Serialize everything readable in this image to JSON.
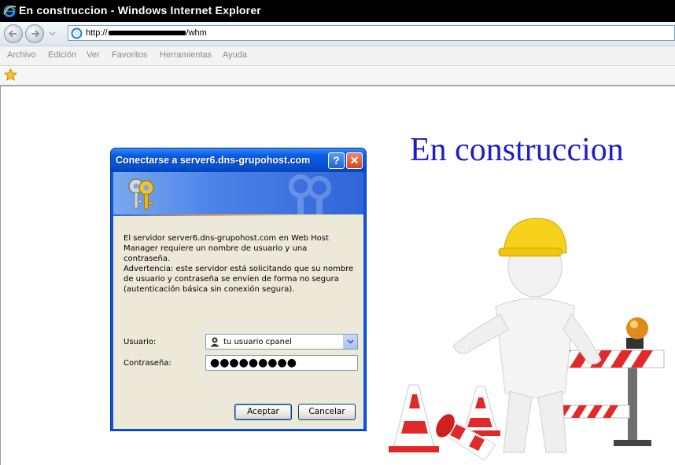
{
  "window": {
    "title": "En construccion - Windows Internet Explorer"
  },
  "address_bar": {
    "url_prefix": "http://",
    "url_suffix": "/whm"
  },
  "menu": [
    "Archivo",
    "Edición",
    "Ver",
    "Favoritos",
    "Herramientas",
    "Ayuda"
  ],
  "page": {
    "heading": "En construccion",
    "heading_color": "#1e1ec8"
  },
  "dialog": {
    "title": "Conectarse a server6.dns-grupohost.com",
    "help_label": "?",
    "close_label": "✕",
    "message": "El servidor server6.dns-grupohost.com en Web Host Manager requiere un nombre de usuario y una contraseña.",
    "warning": "Advertencia: este servidor está solicitando que su nombre de usuario y contraseña se envíen de forma no segura (autenticación básica sin conexión segura).",
    "user_label": "Usuario:",
    "user_value": "tu usuario cpanel",
    "password_label": "Contraseña:",
    "password_value": "●●●●●●●●●",
    "ok_label": "Aceptar",
    "cancel_label": "Cancelar"
  },
  "icons": {
    "browser": "ie-icon",
    "back": "back-arrow-icon",
    "forward": "forward-arrow-icon",
    "page": "page-icon",
    "favorites": "star-icon",
    "keys": "keys-icon",
    "user": "user-icon",
    "dropdown": "chevron-down-icon"
  },
  "colors": {
    "xp_blue": "#0b55de",
    "dialog_face": "#ece9d8"
  }
}
